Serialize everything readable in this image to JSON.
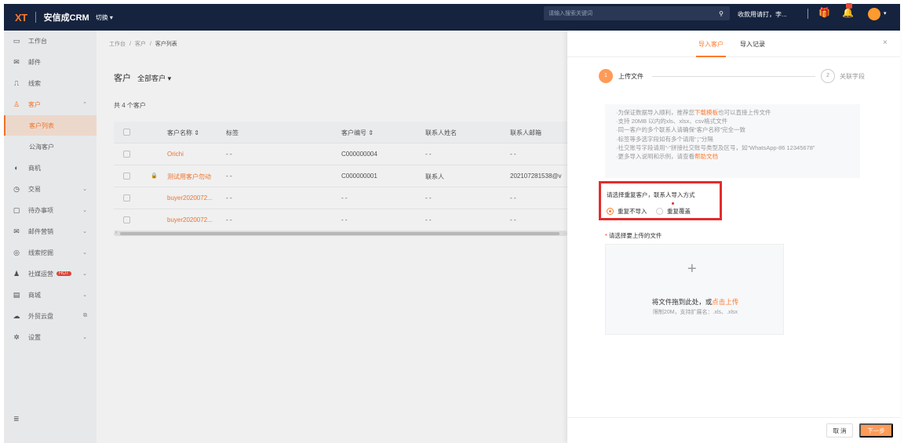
{
  "topbar": {
    "logo_x": "XT",
    "logo_sep": "|",
    "app_name": "安信成CRM",
    "switch_label": "切换 ▾",
    "search_placeholder": "请输入搜索关键词",
    "search_icon": "search-icon",
    "notice": "收款用请打，孛...",
    "gift_icon": "gift-icon",
    "bell_icon": "bell-icon",
    "caret": "▾"
  },
  "sidebar": {
    "items": [
      {
        "icon": "monitor-icon",
        "glyph": "▭",
        "label": "工作台"
      },
      {
        "icon": "mail-icon",
        "glyph": "✉",
        "label": "邮件"
      },
      {
        "icon": "leads-icon",
        "glyph": "⎍",
        "label": "线索"
      },
      {
        "icon": "customer-icon",
        "glyph": "♙",
        "label": "客户",
        "chevron": "⌃"
      },
      {
        "label": "客户列表"
      },
      {
        "label": "公海客户"
      },
      {
        "icon": "opportunity-icon",
        "glyph": "◐",
        "label": "商机"
      },
      {
        "icon": "deal-icon",
        "glyph": "◷",
        "label": "交易",
        "chevron": "⌄"
      },
      {
        "icon": "todo-icon",
        "glyph": "▢",
        "label": "待办事项",
        "chevron": "⌄"
      },
      {
        "icon": "email-marketing-icon",
        "glyph": "✉",
        "label": "邮件营销",
        "chevron": "⌄"
      },
      {
        "icon": "lead-mining-icon",
        "glyph": "◎",
        "label": "线索挖掘",
        "chevron": "⌄"
      },
      {
        "icon": "social-icon",
        "glyph": "♟",
        "label": "社媒运营",
        "badge": "HOT",
        "chevron": "⌄"
      },
      {
        "icon": "store-icon",
        "glyph": "▤",
        "label": "商城",
        "chevron": "⌄"
      },
      {
        "icon": "cloud-icon",
        "glyph": "☁",
        "label": "外贸云盘",
        "chevron": "⧉"
      },
      {
        "icon": "settings-icon",
        "glyph": "✲",
        "label": "设置",
        "chevron": "⌄"
      }
    ],
    "fold_icon": "≣"
  },
  "main": {
    "breadcrumb": [
      "工作台",
      "/",
      "客户",
      "/",
      "客户列表"
    ],
    "title": "客户",
    "filter": "全部客户 ▾",
    "count": "共 4 个客户",
    "columns": [
      "客户名称 ⇕",
      "标签",
      "客户编号 ⇕",
      "联系人姓名",
      "联系人邮箱"
    ],
    "rows": [
      {
        "name": "Orichi",
        "tag": "- -",
        "code": "C000000004",
        "contact": "- -",
        "email": "- -",
        "lock": ""
      },
      {
        "name": "测试用客户勿动",
        "tag": "- -",
        "code": "C000000001",
        "contact": "联系人",
        "email": "202107281538@v",
        "lock": "🔒"
      },
      {
        "name": "buyer2020072...",
        "tag": "- -",
        "code": "- -",
        "contact": "- -",
        "email": "- -",
        "lock": ""
      },
      {
        "name": "buyer2020072...",
        "tag": "- -",
        "code": "- -",
        "contact": "- -",
        "email": "- -",
        "lock": ""
      }
    ],
    "scroll_arrow": "‹"
  },
  "drawer": {
    "tabs": [
      "导入客户",
      "导入记录"
    ],
    "close": "×",
    "steps": [
      {
        "num": "1",
        "label": "上传文件"
      },
      {
        "num": "2",
        "label": "关联字段"
      }
    ],
    "tips": {
      "line1_pre": "·为保证数据导入顺利，推荐您",
      "line1_link": "下载模板",
      "line1_post": "也可以直接上传文件",
      "line2": "·支持 20MB 以内的xls、xlsx、csv格式文件",
      "line3": "·同一客户的多个联系人请确保“客户名称”完全一致",
      "line4": "·标签等多选字段如有多个请用“；”分隔",
      "line5": "·社交账号字段请用“-”拼接社交账号类型及区号，如“WhatsApp-86 12345678”",
      "line6_pre": "·更多导入说明和示例，请查看",
      "line6_link": "帮助文档"
    },
    "repeat": {
      "title": "请选择重复客户，联系人导入方式",
      "options": [
        "重复不导入",
        "重复覆盖"
      ],
      "selected": "重复不导入"
    },
    "file_label": "请选择要上传的文件",
    "file_required": "*",
    "upload": {
      "plus": "+",
      "text_pre": "将文件拖到此处，或",
      "text_link": "点击上传",
      "sub": "限制20M，支持扩展名：.xls、.xlsx"
    },
    "footer": {
      "cancel": "取 消",
      "next": "下一步"
    }
  },
  "colors": {
    "accent": "#ff7a2e",
    "topbar": "#15233f",
    "highlight_box": "#e32c2c"
  }
}
